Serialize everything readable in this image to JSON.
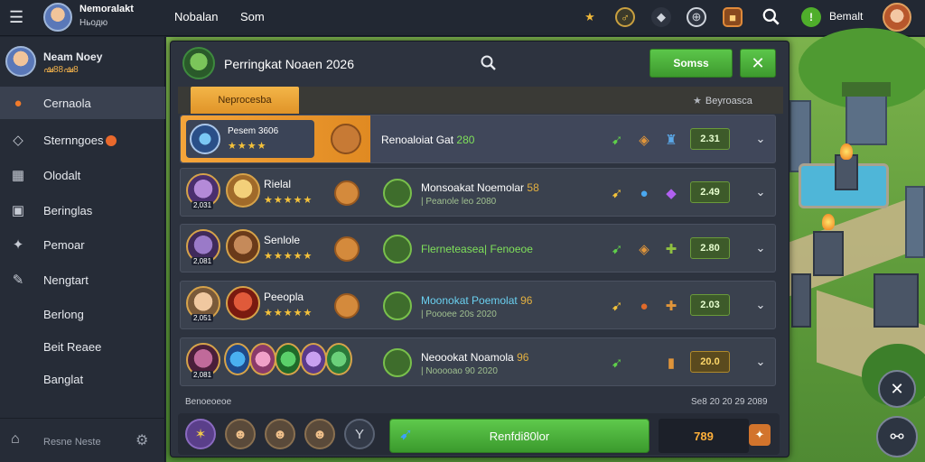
{
  "topbar": {
    "player_name": "Nemoralakt",
    "player_sub": "Ньодю",
    "links": [
      "Nobalan",
      "Som"
    ],
    "level_badge": "!",
    "level_name": "Bemalt",
    "icons": [
      "trophy-icon",
      "coin-icon",
      "shield-icon",
      "globe-icon",
      "chest-icon",
      "search-icon"
    ]
  },
  "sidebar": {
    "profile_name": "Neam Noey",
    "profile_sub": "ഷ88ഷ8",
    "items": [
      {
        "label": "Cernaola",
        "icon": "fire-icon",
        "active": true
      },
      {
        "label": "Sternngoes",
        "icon": "shield-icon",
        "badge": true
      },
      {
        "label": "Olodalt",
        "icon": "grid-icon"
      },
      {
        "label": "Beringlas",
        "icon": "note-icon"
      },
      {
        "label": "Pemoar",
        "icon": "puzzle-icon"
      },
      {
        "label": "Nengtart",
        "icon": "pen-icon"
      },
      {
        "label": "Berlong",
        "icon": ""
      },
      {
        "label": "Beit Reaee",
        "icon": ""
      },
      {
        "label": "Banglat",
        "icon": ""
      }
    ],
    "footer_label": "Resne Neste"
  },
  "panel": {
    "title": "Perringkat Noaen 2026",
    "action_label": "Somss",
    "tab_label": "Neprocesba",
    "sub_right": "Beyroasca",
    "rows": [
      {
        "name": "Pesem 3606",
        "stars": "★★★★",
        "title": "Renoaloiat Gat",
        "title_num": "280",
        "sub": "",
        "score": "2.31",
        "score_style": "green",
        "icons": [
          "bolt-icon",
          "ring-icon",
          "armor-icon"
        ]
      },
      {
        "name": "Rielal",
        "stars": "★★★★★",
        "hero_levels": [
          "2,031",
          ""
        ],
        "title": "Monsoakat Noemolar",
        "title_num": "58",
        "title_style": "white",
        "sub": "| Peanole leo 2080",
        "score": "2.49",
        "score_style": "green",
        "icons": [
          "bolt-icon",
          "orb-icon",
          "gem-icon"
        ]
      },
      {
        "name": "Senlole",
        "stars": "★★★★★",
        "hero_levels": [
          "2,081",
          ""
        ],
        "title": "Flerneteasea| Fenoeoe",
        "title_num": "",
        "title_style": "green",
        "sub": "",
        "score": "2.80",
        "score_style": "green",
        "icons": [
          "bolt-icon",
          "ring-icon",
          "cross-icon"
        ]
      },
      {
        "name": "Peeopla",
        "stars": "★★★★★",
        "hero_levels": [
          "2,051",
          ""
        ],
        "title": "Moonokat Poemolat",
        "title_num": "96",
        "title_style": "cyan",
        "sub": "| Poooee 20s 2020",
        "score": "2.03",
        "score_style": "green",
        "icons": [
          "bolt-icon",
          "potion-icon",
          "cross-icon"
        ]
      },
      {
        "name": "",
        "stars": "",
        "hero_levels": [
          "2,081",
          ""
        ],
        "title": "Neoookat Noamola",
        "title_num": "96",
        "title_style": "white",
        "sub": "| Nooooao 90 2020",
        "score": "20.0",
        "score_style": "orange",
        "icons": [
          "bolt-icon",
          "book-icon"
        ]
      }
    ],
    "footer_left": "Benoeoeoe",
    "footer_right": "Se8 20 20 29 2089",
    "cta_label": "Renfdi80lor",
    "cta_value": "789"
  },
  "colors": {
    "accent_green": "#4fae2b",
    "accent_orange": "#f0a03a",
    "panel_bg": "#2d333f"
  }
}
